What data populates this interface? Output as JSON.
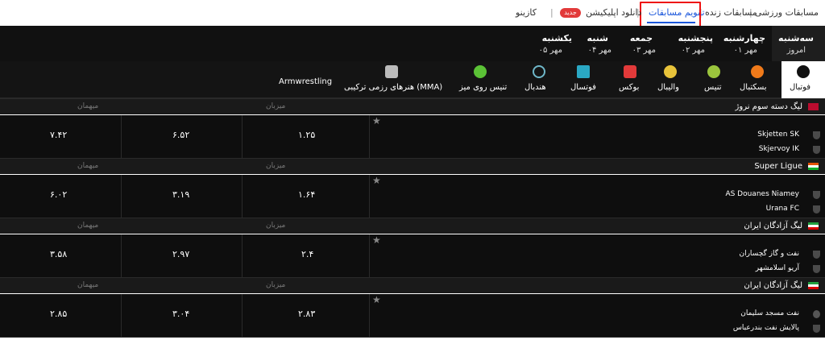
{
  "nav": {
    "sports": "مسابقات ورزشی",
    "live": "مسابقات زنده",
    "calendar": "تقویم مسابقات",
    "app": "دانلود اپلیکیشن",
    "badge_new": "جدید",
    "casino": "کازینو"
  },
  "days": [
    {
      "name": "سه‌شنبه",
      "date": "امروز"
    },
    {
      "name": "چهارشنبه",
      "date": "۰۱ مهر"
    },
    {
      "name": "پنجشنبه",
      "date": "۰۲ مهر"
    },
    {
      "name": "جمعه",
      "date": "۰۳ مهر"
    },
    {
      "name": "شنبه",
      "date": "۰۴ مهر"
    },
    {
      "name": "یکشنبه",
      "date": "۰۵ مهر"
    }
  ],
  "sports": [
    {
      "label": "فوتبال",
      "icon": "football-icon",
      "color": "#ffffff"
    },
    {
      "label": "بسکتبال",
      "icon": "basketball-icon",
      "color": "#f07a1a"
    },
    {
      "label": "تنیس",
      "icon": "tennis-icon",
      "color": "#9bc53d"
    },
    {
      "label": "والیبال",
      "icon": "volleyball-icon",
      "color": "#e8c33a"
    },
    {
      "label": "بوکس",
      "icon": "boxing-icon",
      "color": "#e23a3a"
    },
    {
      "label": "فوتسال",
      "icon": "futsal-icon",
      "color": "#2aa8c4"
    },
    {
      "label": "هندبال",
      "icon": "handball-icon",
      "color": "#6fb7c9"
    },
    {
      "label": "تنیس روی میز",
      "icon": "table-tennis-icon",
      "color": "#5bc236"
    },
    {
      "label": "هنرهای رزمی ترکیبی (MMA)",
      "icon": "mma-icon",
      "color": "#bbbbbb"
    },
    {
      "label": "Armwrestling",
      "icon": "",
      "color": ""
    }
  ],
  "col_home": "میزبان",
  "col_away": "میهمان",
  "leagues": [
    {
      "name": "لیگ دسته سوم نروژ",
      "flag": "norway",
      "home": "Skjetten SK",
      "away": "Skjervoy IK",
      "odds": [
        "۱.۲۵",
        "۶.۵۲",
        "۷.۴۲"
      ]
    },
    {
      "name": "Super Ligue",
      "flag": "niger",
      "home": "AS Douanes Niamey",
      "away": "Urana FC",
      "odds": [
        "۱.۶۴",
        "۳.۱۹",
        "۶.۰۲"
      ]
    },
    {
      "name": "لیگ آزادگان ایران",
      "flag": "iran",
      "home": "نفت و گاز گچساران",
      "away": "آریو اسلامشهر",
      "odds": [
        "۲.۴",
        "۲.۹۷",
        "۳.۵۸"
      ]
    },
    {
      "name": "لیگ آزادگان ایران",
      "flag": "iran",
      "home": "نفت مسجد سلیمان",
      "away": "پالایش نفت بندرعباس",
      "odds": [
        "۲.۸۳",
        "۳.۰۴",
        "۲.۸۵"
      ]
    }
  ]
}
